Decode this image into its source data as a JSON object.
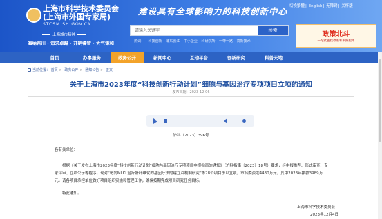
{
  "header": {
    "org_line1": "上海市科学技术委员会",
    "org_line2": "(上海市外国专家局)",
    "domain": "STCSM.SH.GOV.CN",
    "spirit": "上海城市精神",
    "motto": "海纳百川 · 追求卓越 · 开明睿智 · 大气谦和",
    "slogan": "建设具有全球影响力的科技创新中心",
    "top_links": [
      "切换繁體",
      "English",
      "无障碍",
      "关怀版"
    ],
    "search": {
      "placeholder": "请输入关键字",
      "button": "检索"
    },
    "hot_label": "热词：",
    "hot_words": [
      "科技创新",
      "浦东张江",
      "中小企业",
      "科研院所",
      "一带一路",
      "高新技术"
    ],
    "ad": {
      "title": "政策北斗",
      "subtitle": "一站式查找政策和申报指南"
    }
  },
  "nav": {
    "items": [
      "首页",
      "办事服务",
      "政务公开",
      "新闻中心",
      "互动平台",
      "创新研究",
      "科普天地"
    ],
    "active_index": 2,
    "active_color": "#f3a32a",
    "bar_color": "#2d63c4"
  },
  "breadcrumb": [
    "首页",
    "政务公开",
    "通知公告",
    "正文"
  ],
  "breadcrumb_prefix": "当前位置：",
  "article": {
    "title": "关于上海市2023年度“科技创新行动计划”细胞与基因治疗专项项目立项的通知",
    "date": "发布日期：2023-12-06",
    "doc_number": "沪科〔2023〕396号",
    "salutation": "各有关单位：",
    "body": "根据《关于发布上海市2023年度“科技创新行动计划”细胞与基因治疗专项项目申报指南的通知》（沪科指南〔2023〕18号）要求，经申报推荐、形式审查、专家评审、立项公示等程序，现对“靶向MLKL治疗肝纤维化的基因疗法的建立及机制研究”等28个项目予以立项，市科委资助4430万元，其中2023年拨款3989万元。请各项目承担单位做好项目组织实施和管理工作，确保按期完成项目研究任务目标。",
    "closing": "特此通知。",
    "signature": "上海市科学技术委员会",
    "sign_date": "2023年12月4日"
  },
  "player": {
    "volume": 0.7
  }
}
